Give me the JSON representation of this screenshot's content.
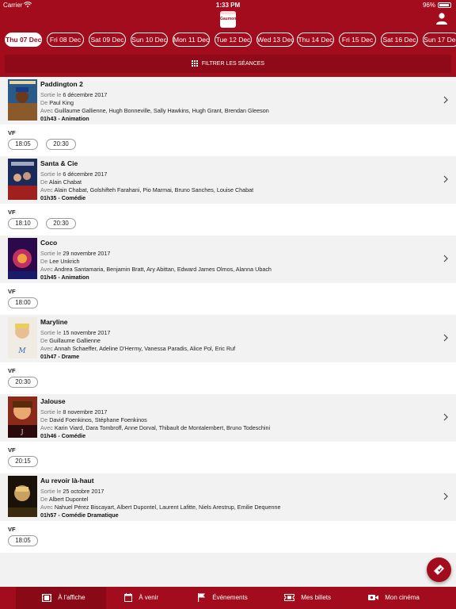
{
  "status": {
    "carrier": "Carrier",
    "time": "1:33 PM",
    "battery": "96%"
  },
  "header": {
    "logo_text": "Gaumont"
  },
  "tabs": [
    "Thu 07 Dec",
    "Fri 08 Dec",
    "Sat 09 Dec",
    "Sun 10 Dec",
    "Mon 11 Dec",
    "Tue 12 Dec",
    "Wed 13 Dec",
    "Thu 14 Dec",
    "Fri 15 Dec",
    "Sat 16 Dec",
    "Sun 17 Dec"
  ],
  "filter": {
    "label": "FILTRER LES SÉANCES"
  },
  "labels": {
    "release": "Sortie le",
    "by": "De",
    "with": "Avec",
    "version": "VF"
  },
  "movies": [
    {
      "title": "Paddington 2",
      "release": "6 décembre 2017",
      "director": "Paul King",
      "cast": "Guillaume Gallienne,  Hugh Bonneville,  Sally Hawkins,  Hugh Grant,  Brendan Gleeson",
      "meta": "01h43 - Animation",
      "times": [
        "18:05",
        "20:30"
      ]
    },
    {
      "title": "Santa & Cie",
      "release": "6 décembre 2017",
      "director": "Alain Chabat",
      "cast": "Alain Chabat,  Golshifteh Farahani,  Pio Marmai,  Bruno Sanches,  Louise Chabat",
      "meta": "01h35 - Comédie",
      "times": [
        "18:10",
        "20:30"
      ]
    },
    {
      "title": "Coco",
      "release": "29 novembre 2017",
      "director": "Lee Unkrich",
      "cast": "Andrea Santamaria,  Benjamin Bratt,  Ary Abittan,  Edward James Olmos,  Alanna Ubach",
      "meta": "01h45 - Animation",
      "times": [
        "18:00"
      ]
    },
    {
      "title": "Maryline",
      "release": "15 novembre 2017",
      "director": "Guillaume Gallienne",
      "cast": "Annah Schaeffer,  Adeline D'Hermy,  Vanessa Paradis,  Alice Pol,  Eric Ruf",
      "meta": "01h47 - Drame",
      "times": [
        "20:30"
      ]
    },
    {
      "title": "Jalouse",
      "release": "8 novembre 2017",
      "director": "David Foenkinos,  Stéphane Foenkinos",
      "cast": "Karin Viard,  Dara Tombroff,  Anne Dorval,  Thibault de Montalembert,  Bruno Todeschini",
      "meta": "01h46 - Comédie",
      "times": [
        "20:15"
      ]
    },
    {
      "title": "Au revoir là-haut",
      "release": "25 octobre 2017",
      "director": "Albert Dupontel",
      "cast": "Nahuel Pérez Biscayart,  Albert Dupontel,  Laurent Lafitte,  Niels Arestrup,  Emilie Dequenne",
      "meta": "01h57 - Comédie Dramatique",
      "times": [
        "18:05"
      ]
    }
  ],
  "nav": [
    "À l'affiche",
    "À venir",
    "Événements",
    "Mes billets",
    "Mon cinéma"
  ],
  "colors": {
    "brand": "#a20c1c",
    "brand_dark": "#8e0a18"
  }
}
